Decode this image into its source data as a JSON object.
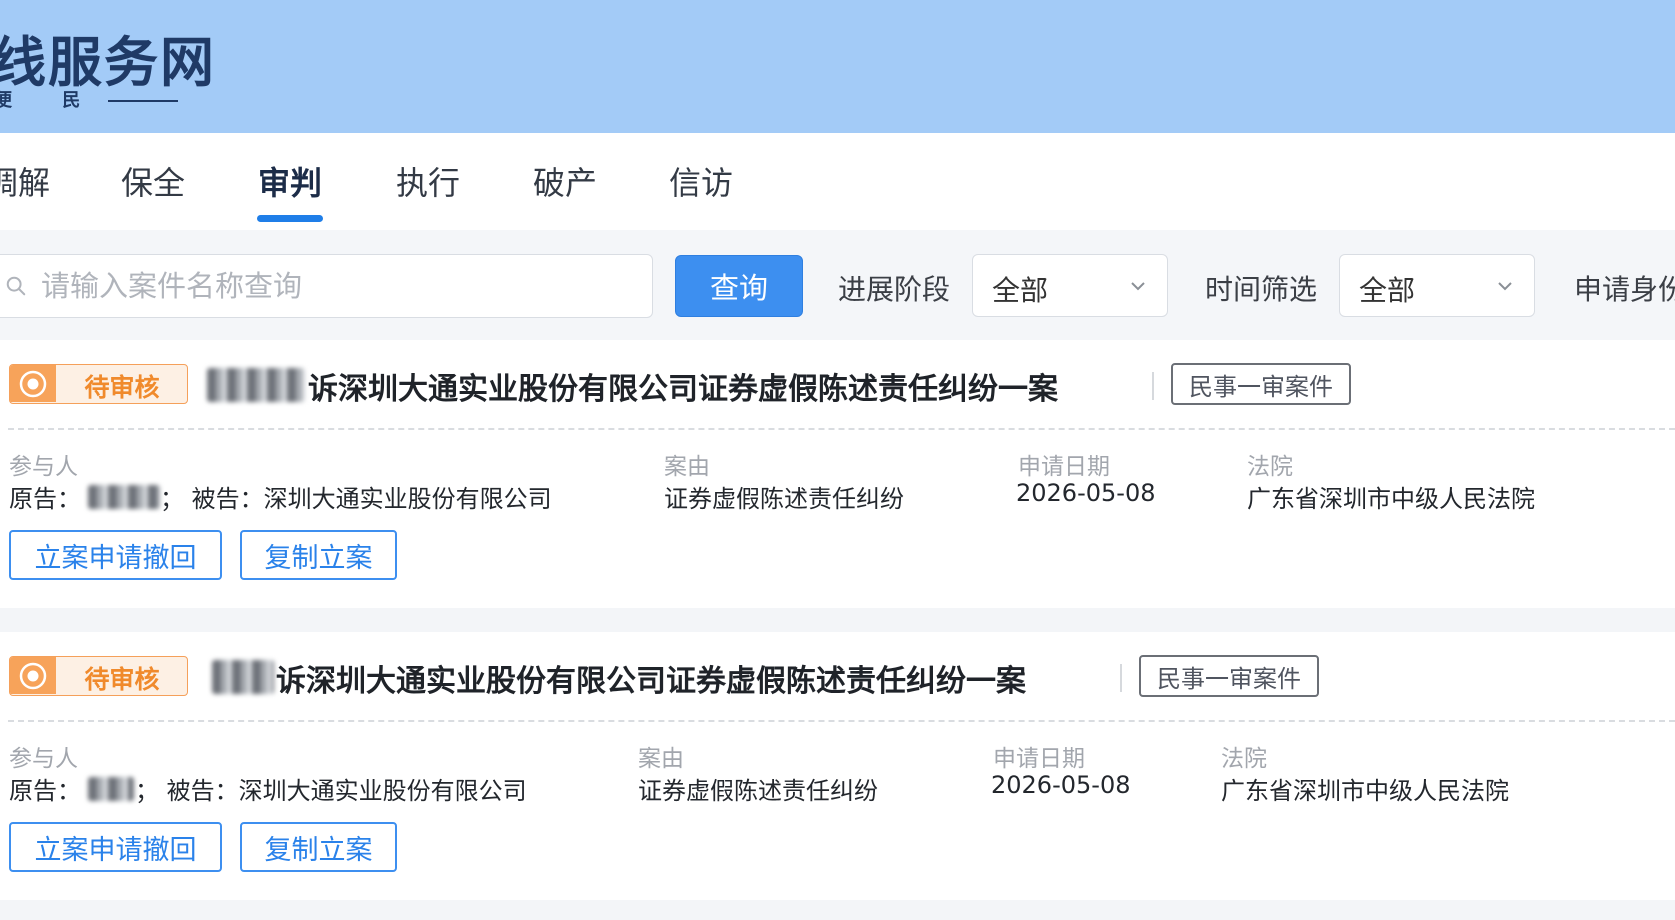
{
  "header": {
    "logo_title": "服务网",
    "logo_title_partial": "线服务网",
    "logo_subtitle": "便 民"
  },
  "nav": {
    "tabs": [
      {
        "label": "调解"
      },
      {
        "label": "保全"
      },
      {
        "label": "审判"
      },
      {
        "label": "执行"
      },
      {
        "label": "破产"
      },
      {
        "label": "信访"
      }
    ],
    "active_tab": "审判"
  },
  "filter": {
    "search_placeholder": "请输入案件名称查询",
    "query_button": "查询",
    "stage_label": "进展阶段",
    "stage_value": "全部",
    "time_label": "时间筛选",
    "time_value": "全部",
    "identity_label_partial": "申请身份"
  },
  "cases": [
    {
      "status": "待审核",
      "title": "诉深圳大通实业股份有限公司证券虚假陈述责任纠纷一案",
      "case_type": "民事一审案件",
      "participants_label": "参与人",
      "plaintiff_prefix": "原告：",
      "defendant_text": "；  被告：深圳大通实业股份有限公司",
      "cause_label": "案由",
      "cause": "证券虚假陈述责任纠纷",
      "date_label": "申请日期",
      "date": "2026-05-08",
      "court_label": "法院",
      "court": "广东省深圳市中级人民法院",
      "withdraw_button": "立案申请撤回",
      "copy_button": "复制立案"
    },
    {
      "status": "待审核",
      "title": "诉深圳大通实业股份有限公司证券虚假陈述责任纠纷一案",
      "case_type": "民事一审案件",
      "participants_label": "参与人",
      "plaintiff_prefix": "原告：",
      "defendant_text": "；  被告：深圳大通实业股份有限公司",
      "cause_label": "案由",
      "cause": "证券虚假陈述责任纠纷",
      "date_label": "申请日期",
      "date": "2026-05-08",
      "court_label": "法院",
      "court": "广东省深圳市中级人民法院",
      "withdraw_button": "立案申请撤回",
      "copy_button": "复制立案"
    }
  ],
  "colors": {
    "header_bg": "#a3cbf7",
    "primary": "#3d8ff0",
    "status_orange": "#f08a2c"
  }
}
